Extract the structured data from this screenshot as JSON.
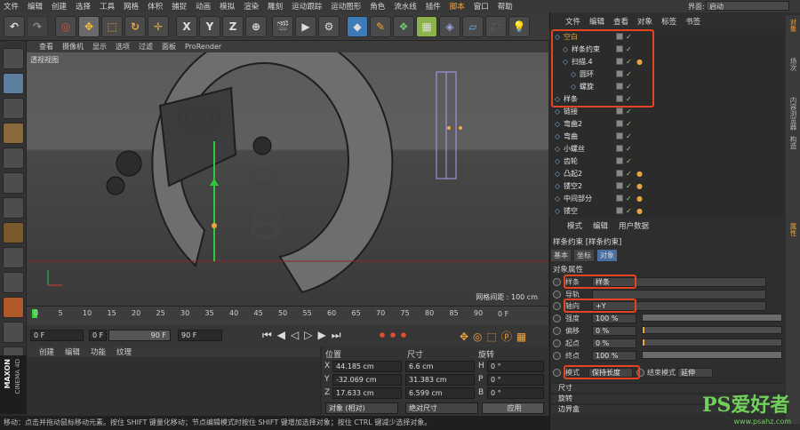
{
  "menubar": {
    "items": [
      "文件",
      "编辑",
      "创建",
      "选择",
      "工具",
      "网格",
      "体积",
      "捕捉",
      "动画",
      "模拟",
      "渲染",
      "雕刻",
      "运动跟踪",
      "运动图形",
      "角色",
      "流水线",
      "插件",
      "脚本",
      "窗口",
      "帮助"
    ],
    "highlight_index": 17
  },
  "toolbar": {
    "axis_labels": [
      "X",
      "Y",
      "Z"
    ]
  },
  "viewport": {
    "menu": [
      "查看",
      "摄像机",
      "显示",
      "选项",
      "过滤",
      "面板",
      "ProRender"
    ],
    "label": "透视视图",
    "grid_text": "网格间距 : 100 cm"
  },
  "timeline": {
    "ticks": [
      "0",
      "5",
      "10",
      "15",
      "20",
      "25",
      "30",
      "35",
      "40",
      "45",
      "50",
      "55",
      "60",
      "65",
      "70",
      "75",
      "80",
      "85",
      "90"
    ],
    "end_label": "0 F"
  },
  "transport": {
    "current": "0 F",
    "start": "0 F",
    "range_end": "90 F",
    "end": "90 F"
  },
  "material_panel": {
    "menu": [
      "创建",
      "编辑",
      "功能",
      "纹理"
    ]
  },
  "coords": {
    "headers": [
      "位置",
      "尺寸",
      "旋转"
    ],
    "rows": [
      {
        "axis": "X",
        "pos": "44.185 cm",
        "size": "6.6 cm",
        "rot_axis": "H",
        "rot": "0 °"
      },
      {
        "axis": "Y",
        "pos": "-32.069 cm",
        "size": "31.383 cm",
        "rot_axis": "P",
        "rot": "0 °"
      },
      {
        "axis": "Z",
        "pos": "17.633 cm",
        "size": "6.599 cm",
        "rot_axis": "B",
        "rot": "0 °"
      }
    ],
    "mode_left": "对象 (相对)",
    "mode_mid": "绝对尺寸",
    "apply": "应用"
  },
  "status": "移动：点击并拖动鼠标移动元素。按住 SHIFT 键量化移动；节点编辑模式时按住 SHIFT 键增加选择对象；按住 CTRL 键减少选择对象。",
  "brand": {
    "line1": "MAXON",
    "line2": "CINEMA 4D"
  },
  "interface": {
    "label": "界面:",
    "value": "启动"
  },
  "object_manager": {
    "menu": [
      "文件",
      "编辑",
      "查看",
      "对象",
      "标签",
      "书签"
    ],
    "objects": [
      {
        "name": "空白",
        "depth": 0,
        "color": "#e8a43a",
        "tags": false
      },
      {
        "name": "样条约束",
        "depth": 1,
        "color": "#e6e6e6",
        "tags": false
      },
      {
        "name": "扫描.4",
        "depth": 1,
        "color": "#e6e6e6",
        "tags": true
      },
      {
        "name": "圆环",
        "depth": 2,
        "color": "#e6e6e6",
        "tags": false
      },
      {
        "name": "螺旋",
        "depth": 2,
        "color": "#e6e6e6",
        "tags": false
      },
      {
        "name": "样条",
        "depth": 0,
        "color": "#e6e6e6",
        "tags": false
      },
      {
        "name": "链接",
        "depth": 0,
        "color": "#e6e6e6",
        "tags": false
      },
      {
        "name": "弯曲2",
        "depth": 0,
        "color": "#e6e6e6",
        "tags": false
      },
      {
        "name": "弯曲",
        "depth": 0,
        "color": "#e6e6e6",
        "tags": false
      },
      {
        "name": "小螺丝",
        "depth": 0,
        "color": "#e6e6e6",
        "tags": false
      },
      {
        "name": "齿轮",
        "depth": 0,
        "color": "#e6e6e6",
        "tags": false
      },
      {
        "name": "凸起2",
        "depth": 0,
        "color": "#e6e6e6",
        "tags": true
      },
      {
        "name": "镂空2",
        "depth": 0,
        "color": "#e6e6e6",
        "tags": true
      },
      {
        "name": "中间部分",
        "depth": 0,
        "color": "#e6e6e6",
        "tags": true
      },
      {
        "name": "镂空",
        "depth": 0,
        "color": "#e6e6e6",
        "tags": true
      }
    ]
  },
  "side_tabs": [
    "对象",
    "场次",
    "内容浏览器",
    "构造"
  ],
  "attr_side_tab": "属性",
  "attributes": {
    "menu": [
      "模式",
      "编辑",
      "用户数据"
    ],
    "title": "样条约束 [样条约束]",
    "tabs": [
      "基本",
      "坐标",
      "对象"
    ],
    "section": "对象属性",
    "spline_label": "样条",
    "spline_value": "样条",
    "rail_label": "导轨",
    "axis_label": "轴向",
    "axis_value": "+Y",
    "strength_label": "强度",
    "strength_value": "100 %",
    "strength_fill": 1.0,
    "offset_label": "偏移",
    "offset_value": "0 %",
    "start_label": "起点",
    "start_value": "0 %",
    "end_label": "终点",
    "end_value": "100 %",
    "end_fill": 1.0,
    "mode_label": "模式",
    "mode_value": "保持长度",
    "endmode_label": "结束模式",
    "endmode_value": "延伸",
    "folds": [
      "尺寸",
      "旋转",
      "边界盒"
    ]
  },
  "watermark": {
    "brand": "PS爱好者",
    "url": "www.psahz.com"
  },
  "colors": {
    "highlight": "#e2451f",
    "accent": "#f2a53a",
    "check": "#8fd17a"
  }
}
